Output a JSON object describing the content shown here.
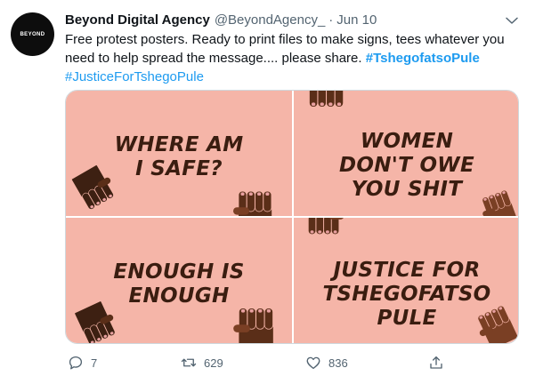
{
  "tweet": {
    "avatar_text": "BEYOND",
    "display_name": "Beyond Digital Agency",
    "handle": "@BeyondAgency_",
    "separator": "·",
    "date": "Jun 10",
    "text": "Free protest posters. Ready to print files to make signs, tees whatever you need to help spread the message.... please share.",
    "hashtags": [
      "#TshegofatsoPule",
      "#JusticeForTshegoPule"
    ]
  },
  "media": {
    "background_color": "#f5b5a8",
    "text_color": "#3a1d10",
    "posters": [
      {
        "lines": [
          "WHERE AM",
          "I SAFE?"
        ]
      },
      {
        "lines": [
          "WOMEN",
          "DON'T OWE",
          "YOU SHIT"
        ]
      },
      {
        "lines": [
          "ENOUGH IS",
          "ENOUGH"
        ]
      },
      {
        "lines": [
          "JUSTICE FOR",
          "TSHEGOFATSO",
          "PULE"
        ]
      }
    ]
  },
  "actions": {
    "reply_count": "7",
    "retweet_count": "629",
    "like_count": "836"
  },
  "icons": [
    "chevron-down-icon",
    "reply-icon",
    "retweet-icon",
    "like-icon",
    "share-icon",
    "raised-fist-icon"
  ],
  "colors": {
    "link": "#1d9bf0",
    "muted": "#536471",
    "text": "#0f1419"
  }
}
